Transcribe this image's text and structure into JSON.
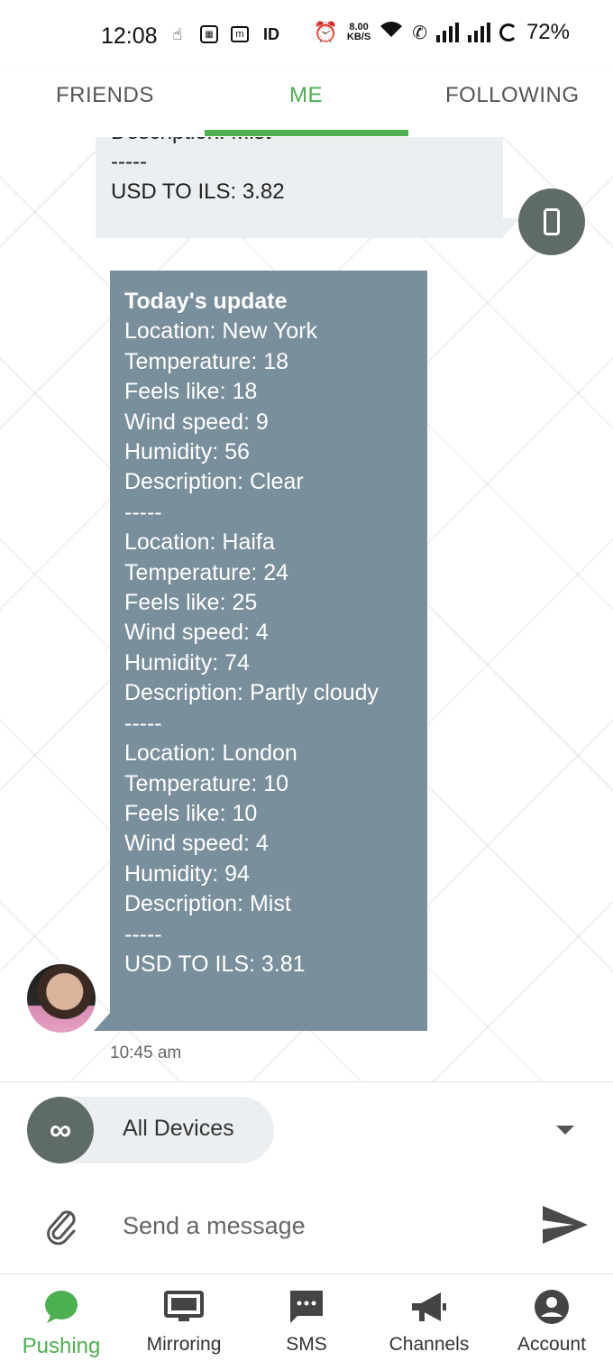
{
  "status_bar": {
    "time": "12:08",
    "net_speed_value": "8.00",
    "net_speed_unit": "KB/S",
    "battery": "72%"
  },
  "tabs": [
    {
      "label": "FRIENDS"
    },
    {
      "label": "ME"
    },
    {
      "label": "FOLLOWING"
    }
  ],
  "outgoing_message": {
    "lines": [
      "Description: Mist",
      "-----",
      "USD TO ILS: 3.82"
    ]
  },
  "incoming_message": {
    "title": "Today's update",
    "lines": [
      "Location: New York",
      "Temperature: 18",
      "Feels like: 18",
      "Wind speed: 9",
      "Humidity: 56",
      "Description: Clear",
      "-----",
      "Location: Haifa",
      "Temperature: 24",
      "Feels like: 25",
      "Wind speed: 4",
      "Humidity: 74",
      "Description: Partly cloudy",
      "-----",
      "Location: London",
      "Temperature: 10",
      "Feels like: 10",
      "Wind speed: 4",
      "Humidity: 94",
      "Description: Mist",
      "-----",
      "USD TO ILS: 3.81"
    ],
    "timestamp": "10:45 am"
  },
  "device_selector": {
    "label": "All Devices"
  },
  "composer": {
    "placeholder": "Send a message"
  },
  "bottom_nav": [
    {
      "label": "Pushing",
      "icon": "chat-bubble-icon"
    },
    {
      "label": "Mirroring",
      "icon": "monitor-icon"
    },
    {
      "label": "SMS",
      "icon": "sms-icon"
    },
    {
      "label": "Channels",
      "icon": "megaphone-icon"
    },
    {
      "label": "Account",
      "icon": "account-circle-icon"
    }
  ],
  "colors": {
    "accent": "#4caf50",
    "incoming_bubble": "#7a8f9c",
    "outgoing_bubble": "#eceff1",
    "device_icon_bg": "#5f6b67"
  }
}
